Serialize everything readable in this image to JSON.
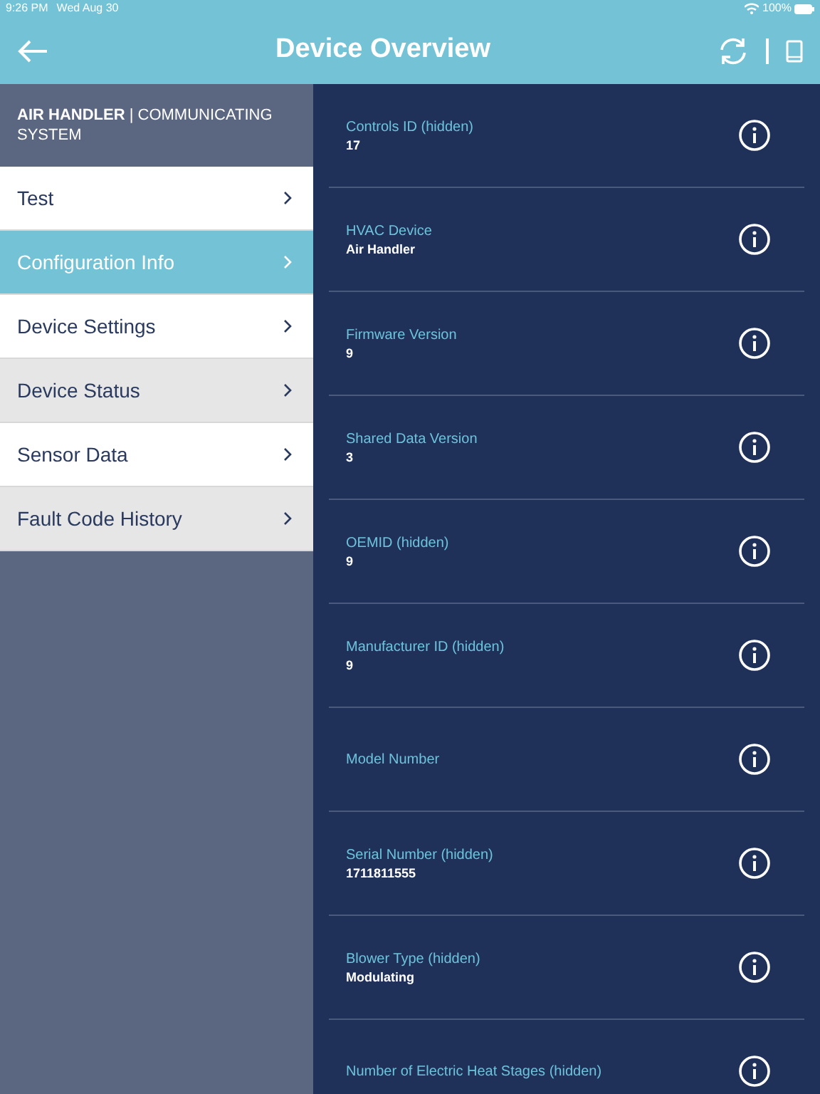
{
  "status_bar": {
    "time": "9:26 PM",
    "date": "Wed Aug 30",
    "battery": "100%"
  },
  "header": {
    "title": "Device Overview"
  },
  "sidebar": {
    "device": "AIR HANDLER",
    "separator": "|",
    "device_type": "COMMUNICATING SYSTEM",
    "items": [
      {
        "label": "Test",
        "selected": false
      },
      {
        "label": "Configuration Info",
        "selected": true
      },
      {
        "label": "Device Settings",
        "selected": false
      },
      {
        "label": "Device Status",
        "selected": false
      },
      {
        "label": "Sensor Data",
        "selected": false
      },
      {
        "label": "Fault Code History",
        "selected": false
      }
    ]
  },
  "fields": [
    {
      "label": "Controls ID (hidden)",
      "value": "17"
    },
    {
      "label": "HVAC Device",
      "value": "Air Handler"
    },
    {
      "label": "Firmware Version",
      "value": "9"
    },
    {
      "label": "Shared Data Version",
      "value": "3"
    },
    {
      "label": "OEMID (hidden)",
      "value": "9"
    },
    {
      "label": "Manufacturer ID (hidden)",
      "value": "9"
    },
    {
      "label": "Model Number"
    },
    {
      "label": "Serial Number (hidden)",
      "value": "1711811555"
    },
    {
      "label": "Blower Type (hidden)",
      "value": "Modulating"
    },
    {
      "label": "Number of Electric Heat Stages (hidden)"
    }
  ]
}
